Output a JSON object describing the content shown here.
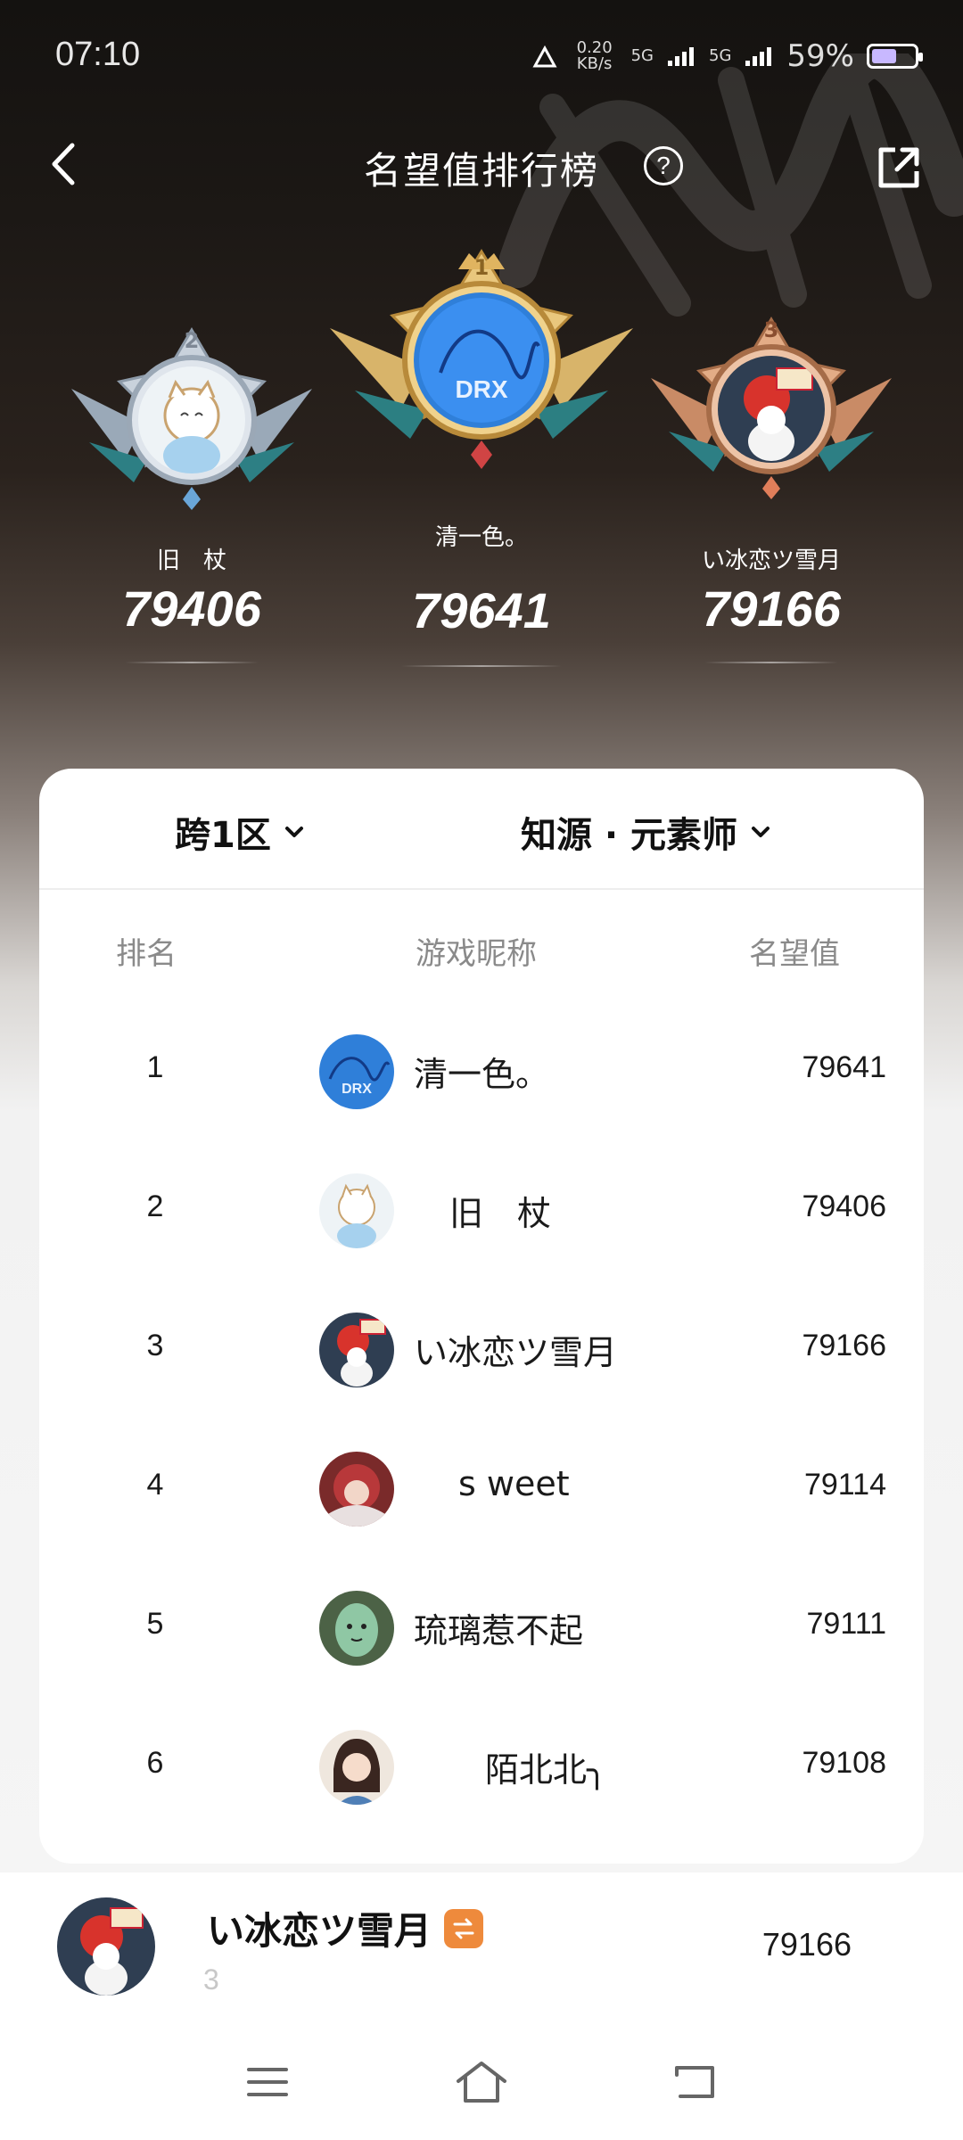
{
  "status_bar": {
    "time": "07:10",
    "net_speed": "0.20 KB/s",
    "net1": "5G",
    "net2": "5G",
    "battery": "59%",
    "battery_level": 0.59
  },
  "header": {
    "title": "名望值排行榜",
    "help_symbol": "?"
  },
  "podium": {
    "first": {
      "rank": "1",
      "name": "清一色。",
      "score": "79641"
    },
    "second": {
      "rank": "2",
      "name": "旧　杖",
      "score": "79406"
    },
    "third": {
      "rank": "3",
      "name": "い冰恋ツ雪月",
      "score": "79166"
    }
  },
  "filters": {
    "server": "跨1区",
    "class": "知源 · 元素师"
  },
  "table": {
    "headers": {
      "rank": "排名",
      "nickname": "游戏昵称",
      "score": "名望值"
    },
    "rows": [
      {
        "rank": "1",
        "nickname": "清一色。",
        "score": "79641"
      },
      {
        "rank": "2",
        "nickname": "旧　杖",
        "score": "79406"
      },
      {
        "rank": "3",
        "nickname": "い冰恋ツ雪月",
        "score": "79166"
      },
      {
        "rank": "4",
        "nickname": "s weet",
        "score": "79114"
      },
      {
        "rank": "5",
        "nickname": "琉璃惹不起",
        "score": "79111"
      },
      {
        "rank": "6",
        "nickname": "陌北北╮",
        "score": "79108"
      }
    ]
  },
  "my_entry": {
    "name": "い冰恋ツ雪月",
    "rank": "3",
    "score": "79166"
  },
  "colors": {
    "accent_orange": "#ee8a3c",
    "gold": "#d9a84a",
    "silver": "#b8c3d0",
    "bronze": "#d59a74"
  }
}
